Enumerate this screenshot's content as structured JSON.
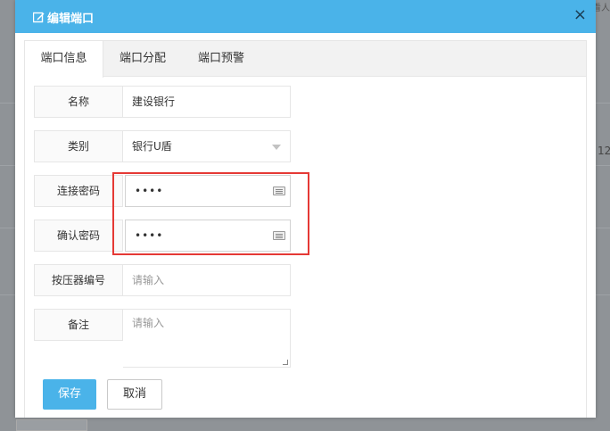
{
  "background": {
    "corner_text": "看人",
    "side_number": "12"
  },
  "dialog": {
    "title": "编辑端口",
    "close_symbol": "×"
  },
  "tabs": [
    {
      "label": "端口信息",
      "active": true
    },
    {
      "label": "端口分配",
      "active": false
    },
    {
      "label": "端口预警",
      "active": false
    }
  ],
  "form": {
    "name": {
      "label": "名称",
      "value": "建设银行"
    },
    "category": {
      "label": "类别",
      "value": "银行U盾"
    },
    "connect_password": {
      "label": "连接密码",
      "value": "••••"
    },
    "confirm_password": {
      "label": "确认密码",
      "value": "••••"
    },
    "presser_id": {
      "label": "按压器编号",
      "placeholder": "请输入"
    },
    "remark": {
      "label": "备注",
      "placeholder": "请输入"
    }
  },
  "buttons": {
    "save": "保存",
    "cancel": "取消"
  },
  "colors": {
    "header": "#4ab3e9",
    "primary_button": "#4ab3e9",
    "highlight": "#e53935"
  }
}
